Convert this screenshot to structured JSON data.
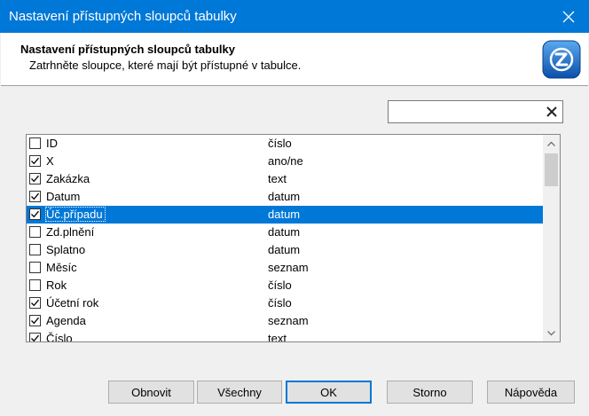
{
  "window": {
    "title": "Nastavení přístupných sloupců tabulky"
  },
  "header": {
    "title": "Nastavení přístupných sloupců tabulky",
    "subtitle": "Zatrhněte sloupce, které mají být přístupné v tabulce."
  },
  "search": {
    "value": "",
    "placeholder": ""
  },
  "columns": [
    {
      "name": "ID",
      "type": "číslo",
      "checked": false,
      "selected": false
    },
    {
      "name": "X",
      "type": "ano/ne",
      "checked": true,
      "selected": false
    },
    {
      "name": "Zakázka",
      "type": "text",
      "checked": true,
      "selected": false
    },
    {
      "name": "Datum",
      "type": "datum",
      "checked": true,
      "selected": false
    },
    {
      "name": "Úč.případu",
      "type": "datum",
      "checked": true,
      "selected": true
    },
    {
      "name": "Zd.plnění",
      "type": "datum",
      "checked": false,
      "selected": false
    },
    {
      "name": "Splatno",
      "type": "datum",
      "checked": false,
      "selected": false
    },
    {
      "name": "Měsíc",
      "type": "seznam",
      "checked": false,
      "selected": false
    },
    {
      "name": "Rok",
      "type": "číslo",
      "checked": false,
      "selected": false
    },
    {
      "name": "Účetní rok",
      "type": "číslo",
      "checked": true,
      "selected": false
    },
    {
      "name": "Agenda",
      "type": "seznam",
      "checked": true,
      "selected": false
    },
    {
      "name": "Číslo",
      "type": "text",
      "checked": true,
      "selected": false
    }
  ],
  "buttons": {
    "refresh": "Obnovit",
    "all": "Všechny",
    "ok": "OK",
    "cancel": "Storno",
    "help": "Nápověda"
  },
  "colors": {
    "titlebar": "#0078d7",
    "selection": "#0078d7"
  }
}
